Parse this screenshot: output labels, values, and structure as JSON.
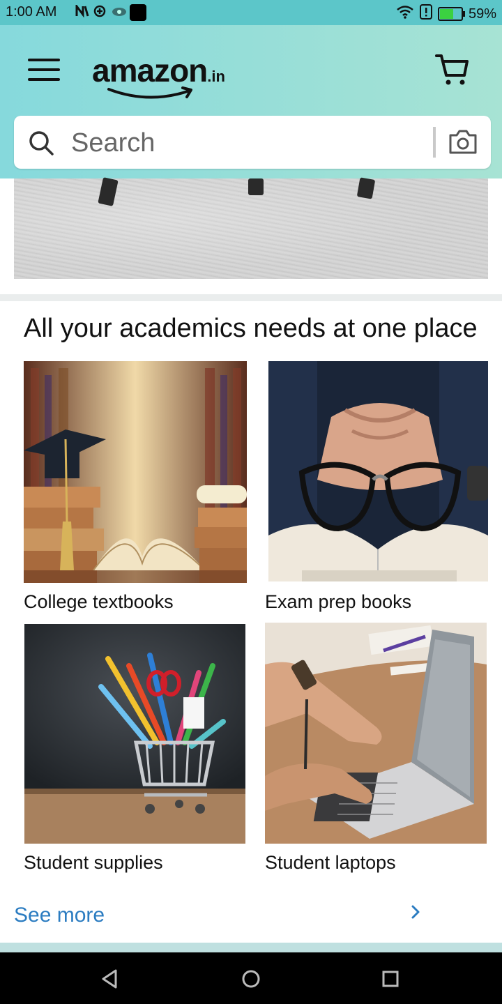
{
  "status_bar": {
    "time": "1:00 AM",
    "battery_percent": "59%",
    "battery_level": 0.59,
    "left_icons": [
      "n-notification-icon",
      "app-notification-icon",
      "eye-icon",
      "black-square-icon"
    ],
    "right_icons": [
      "wifi-icon",
      "alert-icon",
      "battery-charging-icon"
    ]
  },
  "header": {
    "logo_text": "amazon",
    "logo_suffix": ".in",
    "menu_icon": "hamburger-menu-icon",
    "cart_icon": "cart-icon"
  },
  "search": {
    "placeholder": "Search",
    "icon": "search-icon",
    "camera_icon": "camera-icon"
  },
  "colors": {
    "header_gradient_start": "#86d9dc",
    "header_gradient_end": "#a7e3d4",
    "status_bar": "#5cc6c9",
    "link": "#2b7cc1"
  },
  "academics": {
    "title": "All your academics needs at one place",
    "tiles": [
      {
        "label": "College textbooks",
        "image": "books-and-graduation-cap-image"
      },
      {
        "label": "Exam prep books",
        "image": "glasses-on-open-book-image"
      },
      {
        "label": "Student supplies",
        "image": "stationery-cart-image"
      },
      {
        "label": "Student laptops",
        "image": "hands-typing-laptop-image"
      }
    ],
    "see_more": "See more"
  },
  "nav_bar": {
    "back_icon": "back-triangle-icon",
    "home_icon": "home-circle-icon",
    "recents_icon": "recents-square-icon"
  }
}
